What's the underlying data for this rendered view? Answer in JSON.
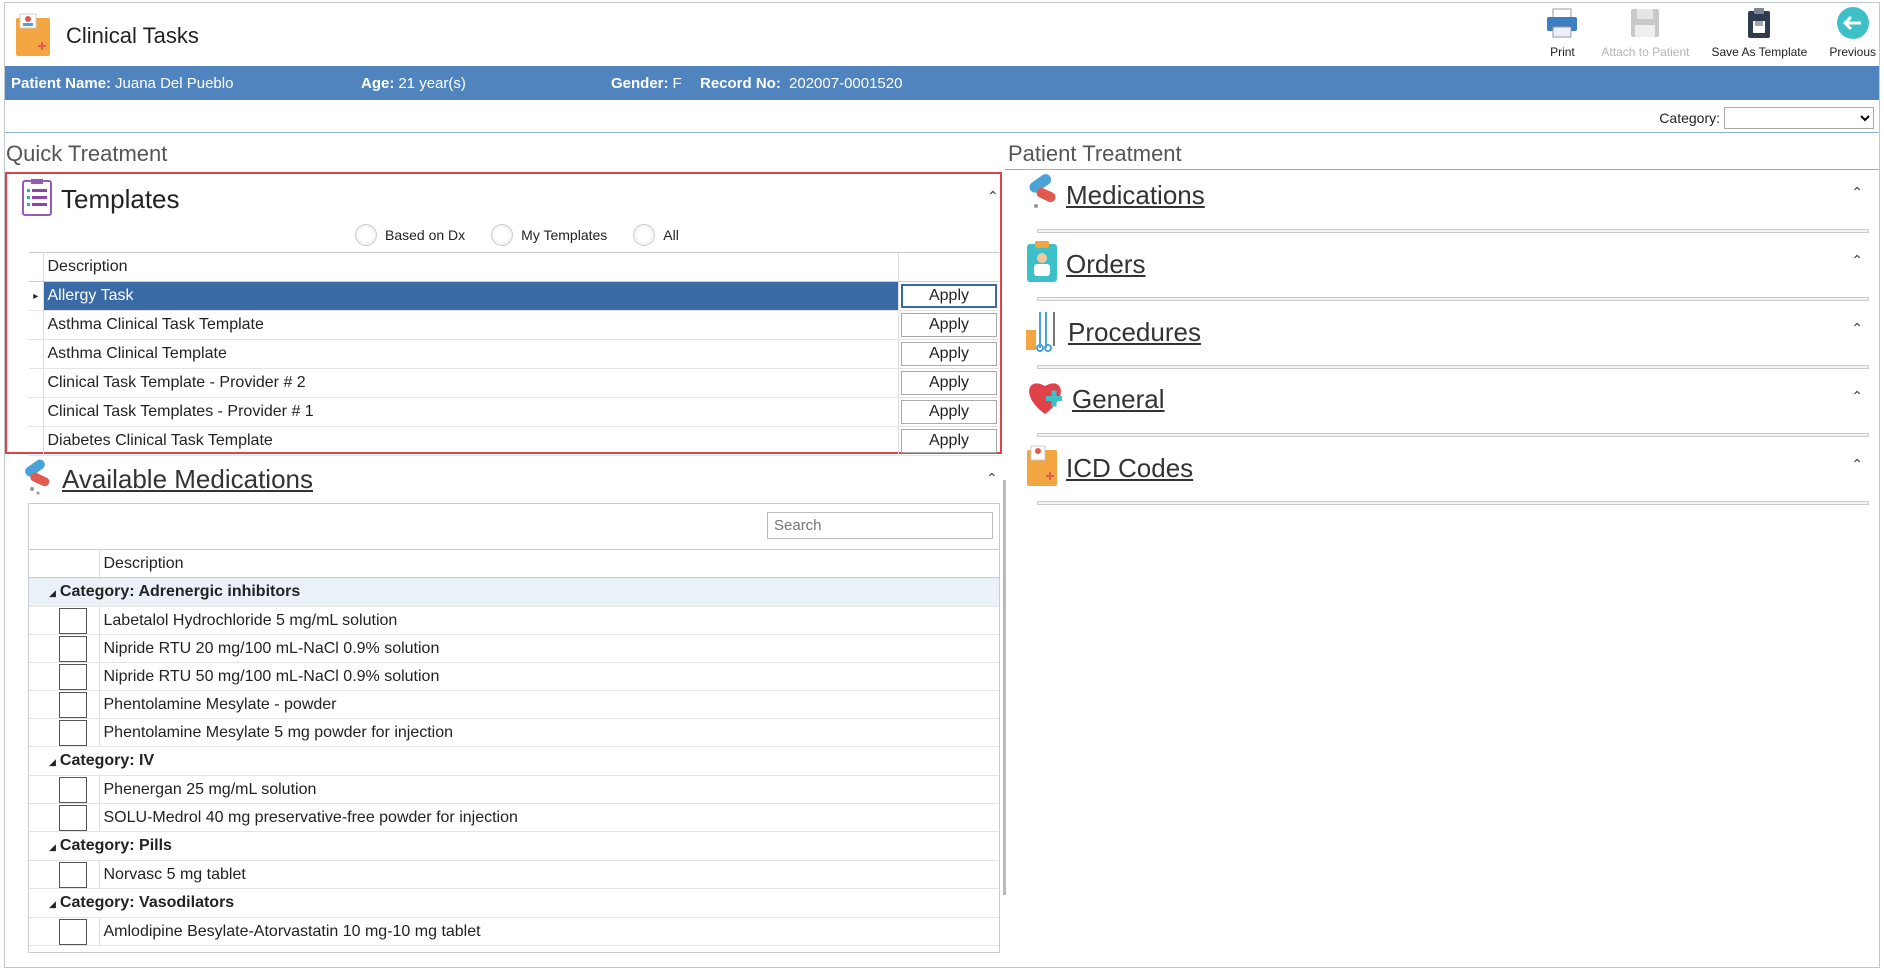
{
  "app": {
    "title": "Clinical Tasks"
  },
  "toolbar": {
    "print": "Print",
    "attach": "Attach to Patient",
    "save_template": "Save As Template",
    "previous": "Previous"
  },
  "patient": {
    "name_label": "Patient Name:",
    "name": "Juana Del Pueblo",
    "age_label": "Age:",
    "age": "21 year(s)",
    "gender_label": "Gender:",
    "gender": "F",
    "record_label": "Record No:",
    "record": "202007-0001520"
  },
  "category": {
    "label": "Category:",
    "value": ""
  },
  "quick_treatment": {
    "title": "Quick Treatment"
  },
  "patient_treatment": {
    "title": "Patient Treatment"
  },
  "templates": {
    "title": "Templates",
    "radios": [
      "Based on Dx",
      "My Templates",
      "All"
    ],
    "column": "Description",
    "apply_label": "Apply",
    "rows": [
      "Allergy Task",
      "Asthma Clinical Task Template",
      "Asthma Clinical Template",
      "Clinical Task Template - Provider # 2",
      "Clinical Task Templates - Provider # 1",
      "Diabetes Clinical Task Template"
    ],
    "selected_index": 0
  },
  "available_medications": {
    "title": "Available Medications",
    "search_placeholder": "Search",
    "column": "Description",
    "groups": [
      {
        "category": "Category: Adrenergic inhibitors",
        "items": [
          "Labetalol Hydrochloride 5 mg/mL solution",
          "Nipride RTU 20 mg/100 mL-NaCl 0.9% solution",
          "Nipride RTU 50 mg/100 mL-NaCl 0.9% solution",
          "Phentolamine Mesylate - powder",
          "Phentolamine Mesylate 5 mg powder for injection"
        ]
      },
      {
        "category": "Category: IV",
        "items": [
          "Phenergan 25 mg/mL solution",
          "SOLU-Medrol 40 mg preservative-free powder for injection"
        ]
      },
      {
        "category": "Category: Pills",
        "items": [
          "Norvasc 5 mg tablet"
        ]
      },
      {
        "category": "Category: Vasodilators",
        "items": [
          "Amlodipine Besylate-Atorvastatin 10 mg-10 mg tablet"
        ]
      }
    ]
  },
  "sections": [
    "Medications",
    "Orders",
    "Procedures",
    "General",
    "ICD Codes"
  ]
}
